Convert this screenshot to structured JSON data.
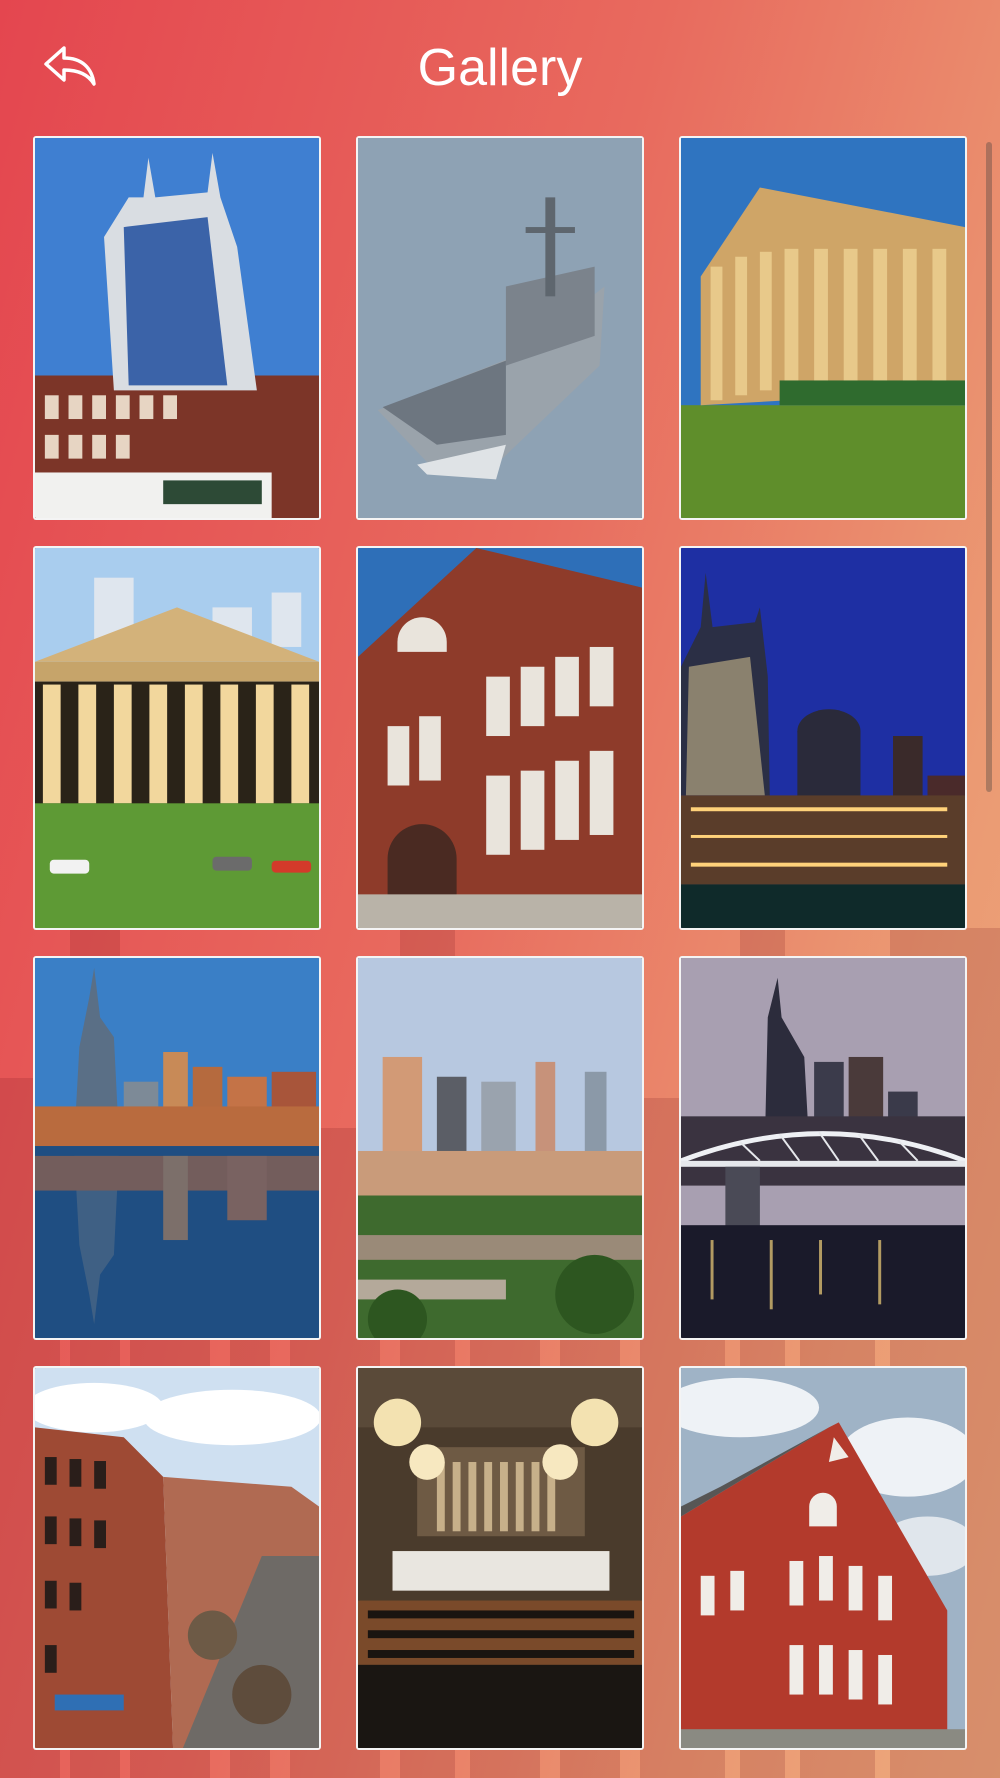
{
  "header": {
    "title": "Gallery",
    "back_icon": "reply-arrow-icon"
  },
  "gallery": {
    "items": [
      {
        "name": "skyscraper-downtown-photo"
      },
      {
        "name": "navy-ship-photo"
      },
      {
        "name": "parthenon-side-photo"
      },
      {
        "name": "parthenon-front-photo"
      },
      {
        "name": "brick-auditorium-photo"
      },
      {
        "name": "night-skyline-photo"
      },
      {
        "name": "river-reflection-skyline-photo"
      },
      {
        "name": "city-overview-photo"
      },
      {
        "name": "pedestrian-bridge-dusk-photo"
      },
      {
        "name": "historic-street-photo"
      },
      {
        "name": "symphony-hall-photo"
      },
      {
        "name": "red-brick-tabernacle-photo"
      }
    ]
  },
  "colors": {
    "gradient_start": "#e4464f",
    "gradient_end": "#edaa7d",
    "text": "#ffffff"
  }
}
